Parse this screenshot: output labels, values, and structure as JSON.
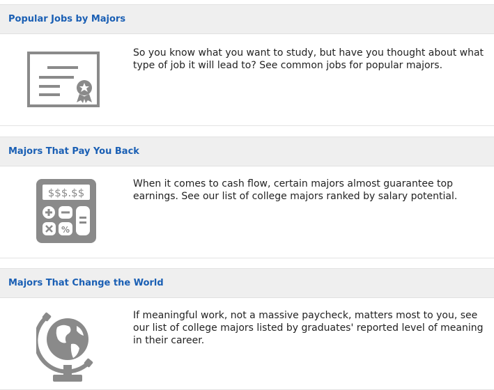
{
  "cards": [
    {
      "title": "Popular Jobs by Majors",
      "description": "So you know what you want to study, but have you thought about what type of job it will lead to? See common jobs for popular majors.",
      "icon": "certificate-icon"
    },
    {
      "title": "Majors That Pay You Back",
      "description": "When it comes to cash flow, certain majors almost guarantee top earnings. See our list of college majors ranked by salary potential.",
      "icon": "calculator-icon",
      "icon_text": "$$$.$$"
    },
    {
      "title": "Majors That Change the World",
      "description": "If meaningful work, not a massive paycheck, matters most to you, see our list of college majors listed by graduates' reported level of meaning in their career.",
      "icon": "globe-icon"
    }
  ],
  "colors": {
    "title": "#1a5fb4",
    "header_bg": "#efefef",
    "icon_gray": "#8a8a8a",
    "text": "#222222"
  }
}
